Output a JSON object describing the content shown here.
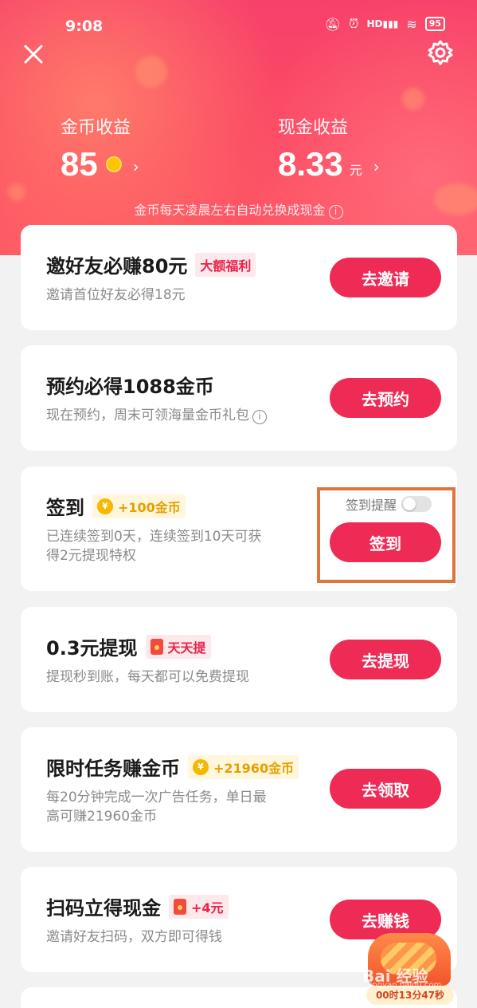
{
  "status_bar": {
    "time": "9:08",
    "network": "HD",
    "battery": "95"
  },
  "header": {
    "coin_label": "金币收益",
    "coin_value": "85",
    "cash_label": "现金收益",
    "cash_value": "8.33",
    "cash_unit": "元",
    "hint": "金币每天凌晨左右自动兑换成现金"
  },
  "tasks": [
    {
      "title": "邀好友必赚80元",
      "tag": "大额福利",
      "desc": "邀请首位好友必得18元",
      "button": "去邀请"
    },
    {
      "title": "预约必得1088金币",
      "desc": "现在预约，周末可领海量金币礼包",
      "button": "去预约"
    },
    {
      "title": "签到",
      "tag_icon": "¥",
      "tag": "+100金币",
      "desc_line1": "已连续签到0天，连续签到10天可获",
      "desc_line2": "得2元提现特权",
      "remind_label": "签到提醒",
      "button": "签到"
    },
    {
      "title": "0.3元提现",
      "tag": "天天提",
      "desc": "提现秒到账，每天都可以免费提现",
      "button": "去提现"
    },
    {
      "title": "限时任务赚金币",
      "tag_icon": "¥",
      "tag": "+21960金币",
      "desc_line1": "每20分钟完成一次广告任务，单日最",
      "desc_line2": "高可赚21960金币",
      "button": "去领取"
    },
    {
      "title": "扫码立得现金",
      "tag": "+4元",
      "desc": "邀请好友扫码，双方即可得钱",
      "button": "去赚钱"
    }
  ],
  "float_widget": {
    "timer": "00时13分47秒"
  },
  "watermark": {
    "text": "Bai 经验",
    "sub": "jingyan.baidu.com"
  },
  "colors": {
    "brand": "#ee2b54",
    "gold": "#e2a100",
    "highlight": "#e0743a"
  }
}
